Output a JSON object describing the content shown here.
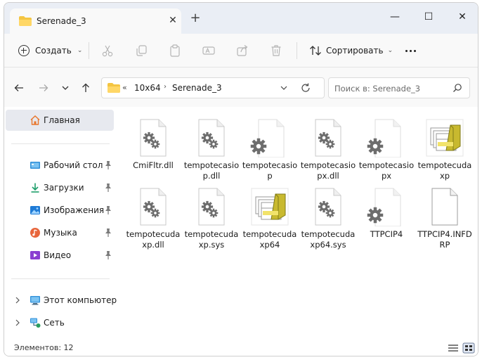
{
  "window": {
    "tab_title": "Serenade_3",
    "tab_close": "✕",
    "new_tab": "+",
    "controls": {
      "minimize": "—",
      "maximize": "☐",
      "close": "✕"
    }
  },
  "toolbar": {
    "create_label": "Создать",
    "sort_label": "Сортировать",
    "chevron": "⌄"
  },
  "address": {
    "overflow": "«",
    "crumbs": [
      "10x64",
      "Serenade_3"
    ],
    "crumb_separator": "›",
    "search_placeholder": "Поиск в: Serenade_3"
  },
  "sidebar": {
    "items": [
      {
        "label": "Главная",
        "icon": "home-icon"
      },
      {
        "label": "Рабочий стол",
        "icon": "desktop-icon",
        "pinned": true
      },
      {
        "label": "Загрузки",
        "icon": "download-icon",
        "pinned": true
      },
      {
        "label": "Изображения",
        "icon": "pictures-icon",
        "pinned": true
      },
      {
        "label": "Музыка",
        "icon": "music-icon",
        "pinned": true
      },
      {
        "label": "Видео",
        "icon": "video-icon",
        "pinned": true
      },
      {
        "label": "Этот компьютер",
        "icon": "computer-icon",
        "expandable": true
      },
      {
        "label": "Сеть",
        "icon": "network-icon",
        "expandable": true
      }
    ]
  },
  "files": [
    {
      "name": "CmiFltr.dll",
      "icon": "dll-gear-icon"
    },
    {
      "name": "tempotecasiop.dll",
      "icon": "dll-gear-icon"
    },
    {
      "name": "tempotecasiop",
      "icon": "settings-file-icon"
    },
    {
      "name": "tempotecasiopx.dll",
      "icon": "dll-gear-icon"
    },
    {
      "name": "tempotecasiopx",
      "icon": "settings-file-icon"
    },
    {
      "name": "tempotecudaxp",
      "icon": "installer-icon"
    },
    {
      "name": "tempotecudaxp.dll",
      "icon": "dll-gear-icon"
    },
    {
      "name": "tempotecudaxp.sys",
      "icon": "dll-gear-icon"
    },
    {
      "name": "tempotecudaxp64",
      "icon": "installer-icon"
    },
    {
      "name": "tempotecudaxp64.sys",
      "icon": "dll-gear-icon"
    },
    {
      "name": "TTPCIP4",
      "icon": "settings-file-icon"
    },
    {
      "name": "TTPCIP4.INFDRP",
      "icon": "blank-file-icon"
    }
  ],
  "status": {
    "item_count": "Элементов: 12"
  },
  "colors": {
    "tabstrip": "#eaeef5",
    "selected": "#e7e9ef",
    "folder": "#f4c542"
  }
}
